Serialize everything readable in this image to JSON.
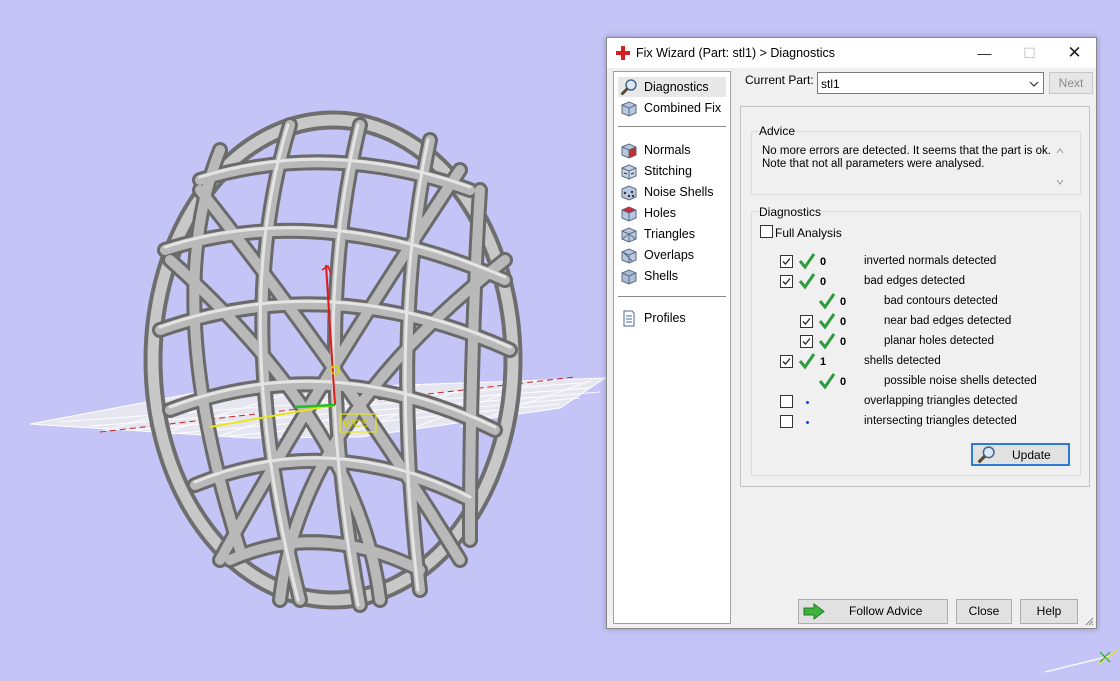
{
  "window": {
    "title": "Fix Wizard (Part: stl1) > Diagnostics",
    "controls": {
      "minimize": "—",
      "maximize": "☐",
      "close": "✕"
    }
  },
  "nav": {
    "items": [
      {
        "label": "Diagnostics",
        "icon": "magnifier-icon",
        "selected": true
      },
      {
        "label": "Combined Fix",
        "icon": "cube-icon"
      },
      {
        "label": "Normals",
        "icon": "normals-cube-icon"
      },
      {
        "label": "Stitching",
        "icon": "stitching-cube-icon"
      },
      {
        "label": "Noise Shells",
        "icon": "noise-shells-cube-icon"
      },
      {
        "label": "Holes",
        "icon": "holes-cube-icon"
      },
      {
        "label": "Triangles",
        "icon": "triangles-cube-icon"
      },
      {
        "label": "Overlaps",
        "icon": "overlaps-cube-icon"
      },
      {
        "label": "Shells",
        "icon": "shells-cube-icon"
      },
      {
        "label": "Profiles",
        "icon": "document-icon"
      }
    ]
  },
  "current_part": {
    "label": "Current Part:",
    "value": "stl1"
  },
  "next_label": "Next",
  "advice": {
    "title": "Advice",
    "line1": "No more errors are detected. It seems that the part is ok.",
    "line2": "Note that not all parameters were analysed."
  },
  "diagnostics": {
    "title": "Diagnostics",
    "full_analysis_label": "Full Analysis",
    "full_analysis_checked": false,
    "rows": [
      {
        "checkbox": true,
        "checked": true,
        "status": "ok",
        "count": "0",
        "label": "inverted normals detected"
      },
      {
        "checkbox": true,
        "checked": true,
        "status": "ok",
        "count": "0",
        "label": "bad edges detected"
      },
      {
        "checkbox": false,
        "checked": false,
        "status": "ok",
        "count": "0",
        "label": "bad contours detected"
      },
      {
        "checkbox": true,
        "checked": true,
        "status": "ok",
        "count": "0",
        "label": "near bad edges detected"
      },
      {
        "checkbox": true,
        "checked": true,
        "status": "ok",
        "count": "0",
        "label": "planar holes detected"
      },
      {
        "checkbox": true,
        "checked": true,
        "status": "ok",
        "count": "1",
        "label": "shells detected"
      },
      {
        "checkbox": false,
        "checked": false,
        "status": "ok",
        "count": "0",
        "label": "possible noise shells detected"
      },
      {
        "checkbox": true,
        "checked": false,
        "status": "not-analysed",
        "count": "",
        "label": "overlapping triangles detected"
      },
      {
        "checkbox": true,
        "checked": false,
        "status": "not-analysed",
        "count": "",
        "label": "intersecting triangles detected"
      }
    ]
  },
  "buttons": {
    "update": "Update",
    "follow_advice": "Follow Advice",
    "close": "Close",
    "help": "Help"
  },
  "viewport": {
    "model_label": "WCS",
    "background_color": "#c4c4f6",
    "accent_check_color": "#2e9b3e"
  }
}
